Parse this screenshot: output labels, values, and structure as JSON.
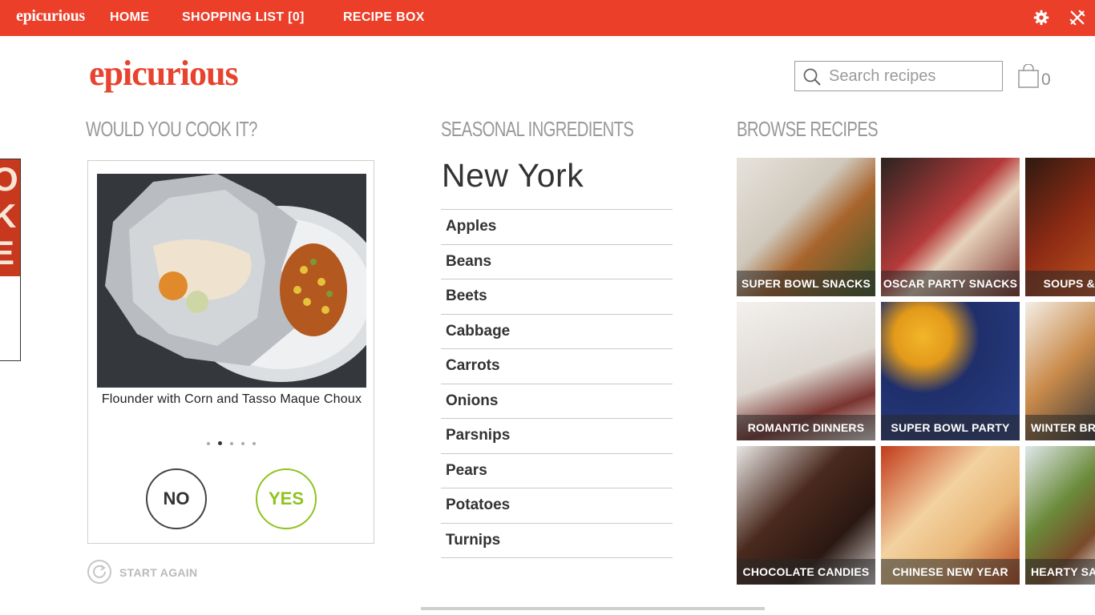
{
  "topbar": {
    "logo": "epicurious",
    "nav": [
      "HOME",
      "SHOPPING LIST [0]",
      "RECIPE BOX"
    ]
  },
  "brand": "epicurious",
  "search": {
    "placeholder": "Search recipes"
  },
  "bag": {
    "count": "0"
  },
  "sections": {
    "cook": "WOULD YOU COOK IT?",
    "seasonal": "SEASONAL INGREDIENTS",
    "browse": "BROWSE RECIPES"
  },
  "cook": {
    "title": "Flounder with Corn and Tasso Maque Choux",
    "no_label": "NO",
    "yes_label": "YES",
    "start_again": "START AGAIN",
    "carousel_total": 5,
    "carousel_active": 2
  },
  "seasonal": {
    "city": "New York",
    "ingredients": [
      "Apples",
      "Beans",
      "Beets",
      "Cabbage",
      "Carrots",
      "Onions",
      "Parsnips",
      "Pears",
      "Potatoes",
      "Turnips"
    ]
  },
  "browse": {
    "tiles": [
      "SUPER BOWL SNACKS",
      "OSCAR PARTY SNACKS",
      "SOUPS &",
      "ROMANTIC DINNERS",
      "SUPER BOWL PARTY",
      "WINTER BR",
      "CHOCOLATE CANDIES",
      "CHINESE NEW YEAR",
      "HEARTY SAL"
    ]
  },
  "colors": {
    "brand_red": "#ec3f2a",
    "yes_green": "#8fc31f"
  }
}
